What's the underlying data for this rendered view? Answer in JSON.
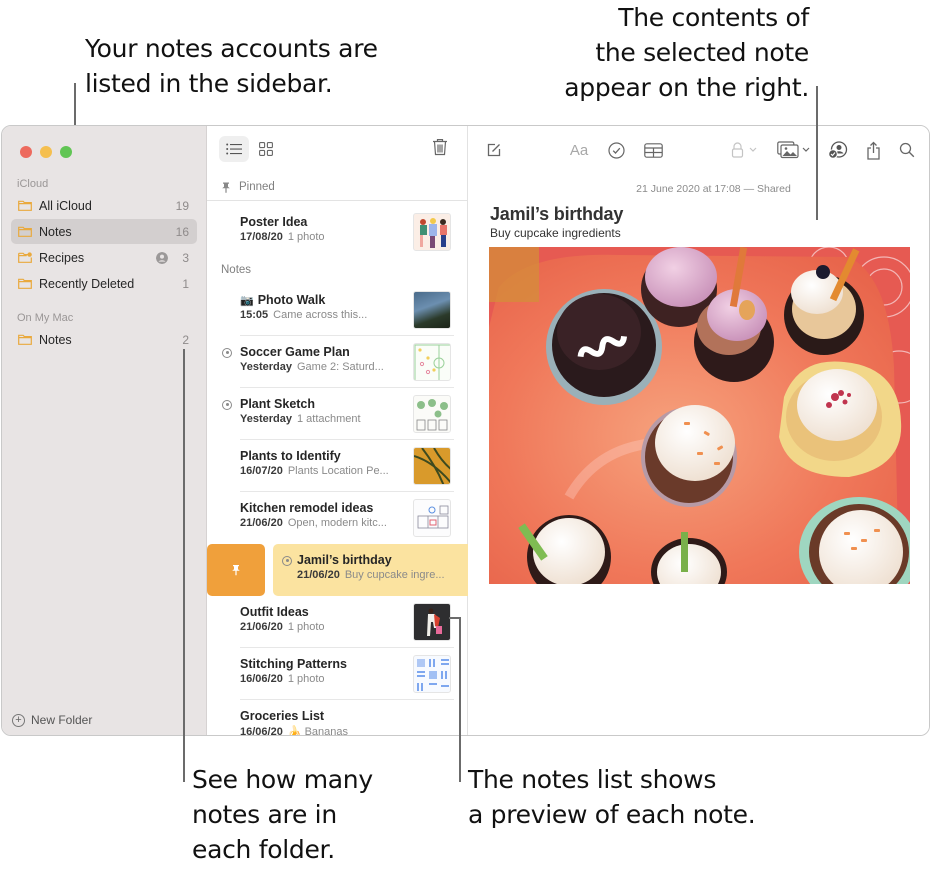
{
  "callouts": {
    "sidebar": [
      "Your notes accounts are",
      "listed in the sidebar."
    ],
    "contents": [
      "The contents of",
      "the selected note",
      "appear on the right."
    ],
    "counts": [
      "See how many",
      "notes are in",
      "each folder."
    ],
    "list": [
      "The notes list shows",
      "a preview of each note."
    ]
  },
  "colors": {
    "close": "#ed6a5e",
    "minimize": "#f5bf4f",
    "zoom": "#61c554",
    "folder": "#e9a93d",
    "selected_note": "#fbe3a0",
    "pin_action": "#f0a03b"
  },
  "sidebar": {
    "sections": [
      {
        "label": "iCloud",
        "folders": [
          {
            "name": "All iCloud",
            "count": "19",
            "selected": false,
            "shared": false,
            "icon": "folder-icon"
          },
          {
            "name": "Notes",
            "count": "16",
            "selected": true,
            "shared": false,
            "icon": "folder-icon"
          },
          {
            "name": "Recipes",
            "count": "3",
            "selected": false,
            "shared": true,
            "icon": "shared-folder-icon"
          },
          {
            "name": "Recently Deleted",
            "count": "1",
            "selected": false,
            "shared": false,
            "icon": "folder-icon"
          }
        ]
      },
      {
        "label": "On My Mac",
        "folders": [
          {
            "name": "Notes",
            "count": "2",
            "selected": false,
            "shared": false,
            "icon": "folder-icon"
          }
        ]
      }
    ],
    "new_folder": "New Folder"
  },
  "notelist": {
    "pinned_label": "Pinned",
    "notes_label": "Notes",
    "pinned": [
      {
        "title": "Poster Idea",
        "date": "17/08/20",
        "preview": "1 photo",
        "shared": false
      }
    ],
    "notes": [
      {
        "title": "Photo Walk",
        "title_prefix": "📷",
        "date": "15:05",
        "preview": "Came across this...",
        "shared": false
      },
      {
        "title": "Soccer Game Plan",
        "date": "Yesterday",
        "preview": "Game 2: Saturd...",
        "shared": true
      },
      {
        "title": "Plant Sketch",
        "date": "Yesterday",
        "preview": "1 attachment",
        "shared": true
      },
      {
        "title": "Plants to Identify",
        "date": "16/07/20",
        "preview": "Plants Location Pe...",
        "shared": false
      },
      {
        "title": "Kitchen remodel ideas",
        "date": "21/06/20",
        "preview": "Open, modern kitc...",
        "shared": false
      },
      {
        "title": "Jamil’s birthday",
        "date": "21/06/20",
        "preview": "Buy cupcake ingre...",
        "shared": true,
        "selected": true
      },
      {
        "title": "Outfit Ideas",
        "date": "21/06/20",
        "preview": "1 photo",
        "shared": false
      },
      {
        "title": "Stitching Patterns",
        "date": "16/06/20",
        "preview": "1 photo",
        "shared": false
      },
      {
        "title": "Groceries List",
        "date": "16/06/20",
        "preview": "🍌 Bananas",
        "shared": false
      }
    ]
  },
  "editor": {
    "toolbar": {
      "compose": "compose-icon",
      "format": "Aa",
      "checklist": "checklist-icon",
      "table": "table-icon",
      "lock": "lock-icon",
      "media": "photo-icon",
      "collaborate": "collaborate-icon",
      "share": "share-icon",
      "search": "search-icon"
    },
    "meta": "21 June 2020 at 17:08 — Shared",
    "title": "Jamil’s birthday",
    "subtitle": "Buy cupcake ingredients",
    "image_alt": "Cupcakes on an orange plate"
  }
}
